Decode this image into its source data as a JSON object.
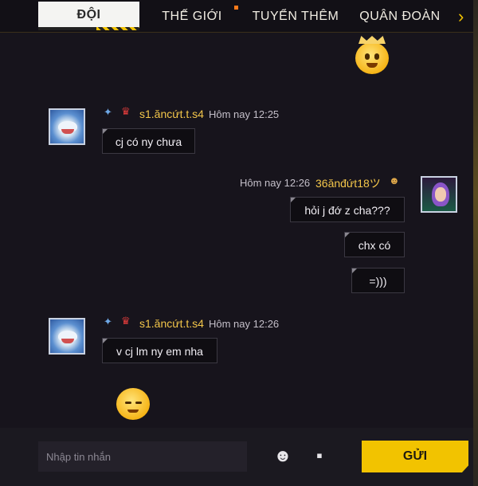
{
  "tabs": [
    {
      "label": "ĐỘI",
      "active": true
    },
    {
      "label": "THẾ GIỚI",
      "active": false
    },
    {
      "label": "TUYỂN THÊM",
      "active": false
    },
    {
      "label": "QUÂN ĐOÀN",
      "active": false
    }
  ],
  "messages": [
    {
      "sender": "s1.ăncứt.t.s4",
      "time": "Hôm nay 12:25",
      "text": "cj có ny chưa"
    },
    {
      "sender": "36ănđứt18ツ",
      "time": "Hôm nay 12:26",
      "texts": [
        "hỏi j đớ z cha???",
        "chx có",
        "=)))"
      ]
    },
    {
      "sender": "s1.ăncứt.t.s4",
      "time": "Hôm nay 12:26",
      "text": "v cj lm ny em nha"
    }
  ],
  "input": {
    "placeholder": "Nhập tin nhắn"
  },
  "send_label": "GỬI",
  "colors": {
    "accent": "#f2c300",
    "name": "#f3c64a",
    "background": "#16131a"
  }
}
